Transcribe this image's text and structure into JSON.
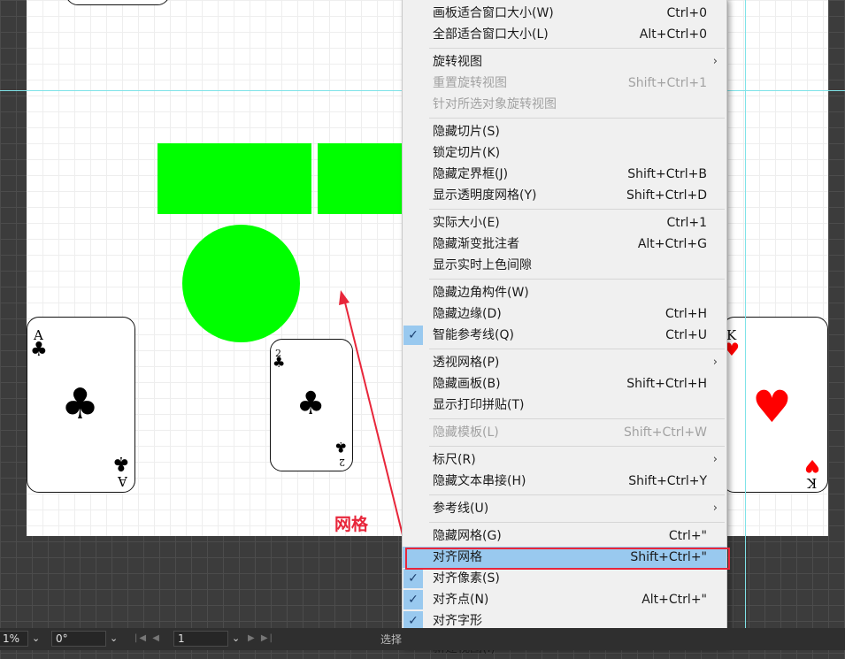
{
  "canvas": {
    "label": "网格",
    "cards": [
      {
        "rank": "A",
        "suit": "♣",
        "color": "#000000"
      },
      {
        "rank": "2",
        "suit": "♣",
        "color": "#000000"
      },
      {
        "rank": "K",
        "suit": "♥",
        "color": "#ff0000"
      }
    ],
    "shape_color": "#00ff00"
  },
  "menu": {
    "items": [
      {
        "label": "画板适合窗口大小(W)",
        "shortcut": "Ctrl+0"
      },
      {
        "label": "全部适合窗口大小(L)",
        "shortcut": "Alt+Ctrl+0"
      },
      {
        "label": "旋转视图",
        "shortcut": ""
      },
      {
        "label": "重置旋转视图",
        "shortcut": "Shift+Ctrl+1"
      },
      {
        "label": "针对所选对象旋转视图",
        "shortcut": ""
      },
      {
        "label": "隐藏切片(S)",
        "shortcut": ""
      },
      {
        "label": "锁定切片(K)",
        "shortcut": ""
      },
      {
        "label": "隐藏定界框(J)",
        "shortcut": "Shift+Ctrl+B"
      },
      {
        "label": "显示透明度网格(Y)",
        "shortcut": "Shift+Ctrl+D"
      },
      {
        "label": "实际大小(E)",
        "shortcut": "Ctrl+1"
      },
      {
        "label": "隐藏渐变批注者",
        "shortcut": "Alt+Ctrl+G"
      },
      {
        "label": "显示实时上色间隙",
        "shortcut": ""
      },
      {
        "label": "隐藏边角构件(W)",
        "shortcut": ""
      },
      {
        "label": "隐藏边缘(D)",
        "shortcut": "Ctrl+H"
      },
      {
        "label": "智能参考线(Q)",
        "shortcut": "Ctrl+U"
      },
      {
        "label": "透视网格(P)",
        "shortcut": ""
      },
      {
        "label": "隐藏画板(B)",
        "shortcut": "Shift+Ctrl+H"
      },
      {
        "label": "显示打印拼贴(T)",
        "shortcut": ""
      },
      {
        "label": "隐藏模板(L)",
        "shortcut": "Shift+Ctrl+W"
      },
      {
        "label": "标尺(R)",
        "shortcut": ""
      },
      {
        "label": "隐藏文本串接(H)",
        "shortcut": "Shift+Ctrl+Y"
      },
      {
        "label": "参考线(U)",
        "shortcut": ""
      },
      {
        "label": "隐藏网格(G)",
        "shortcut": "Ctrl+\""
      },
      {
        "label": "对齐网格",
        "shortcut": "Shift+Ctrl+\""
      },
      {
        "label": "对齐像素(S)",
        "shortcut": ""
      },
      {
        "label": "对齐点(N)",
        "shortcut": "Alt+Ctrl+\""
      },
      {
        "label": "对齐字形",
        "shortcut": ""
      },
      {
        "label": "新建视图(I)",
        "shortcut": ""
      }
    ],
    "check_glyph": "✓",
    "submenu_glyph": "›"
  },
  "statusbar": {
    "zoom": "1%",
    "rotation": "0°",
    "artboard": "1",
    "tool_text": "选择",
    "dropdown_glyph": "⌄",
    "nav_first_prev": "|◀ ◀",
    "nav_next_last": "▶ ▶|"
  },
  "colors": {
    "highlight": "#99c9ef",
    "annotation_red": "#e8263a"
  }
}
